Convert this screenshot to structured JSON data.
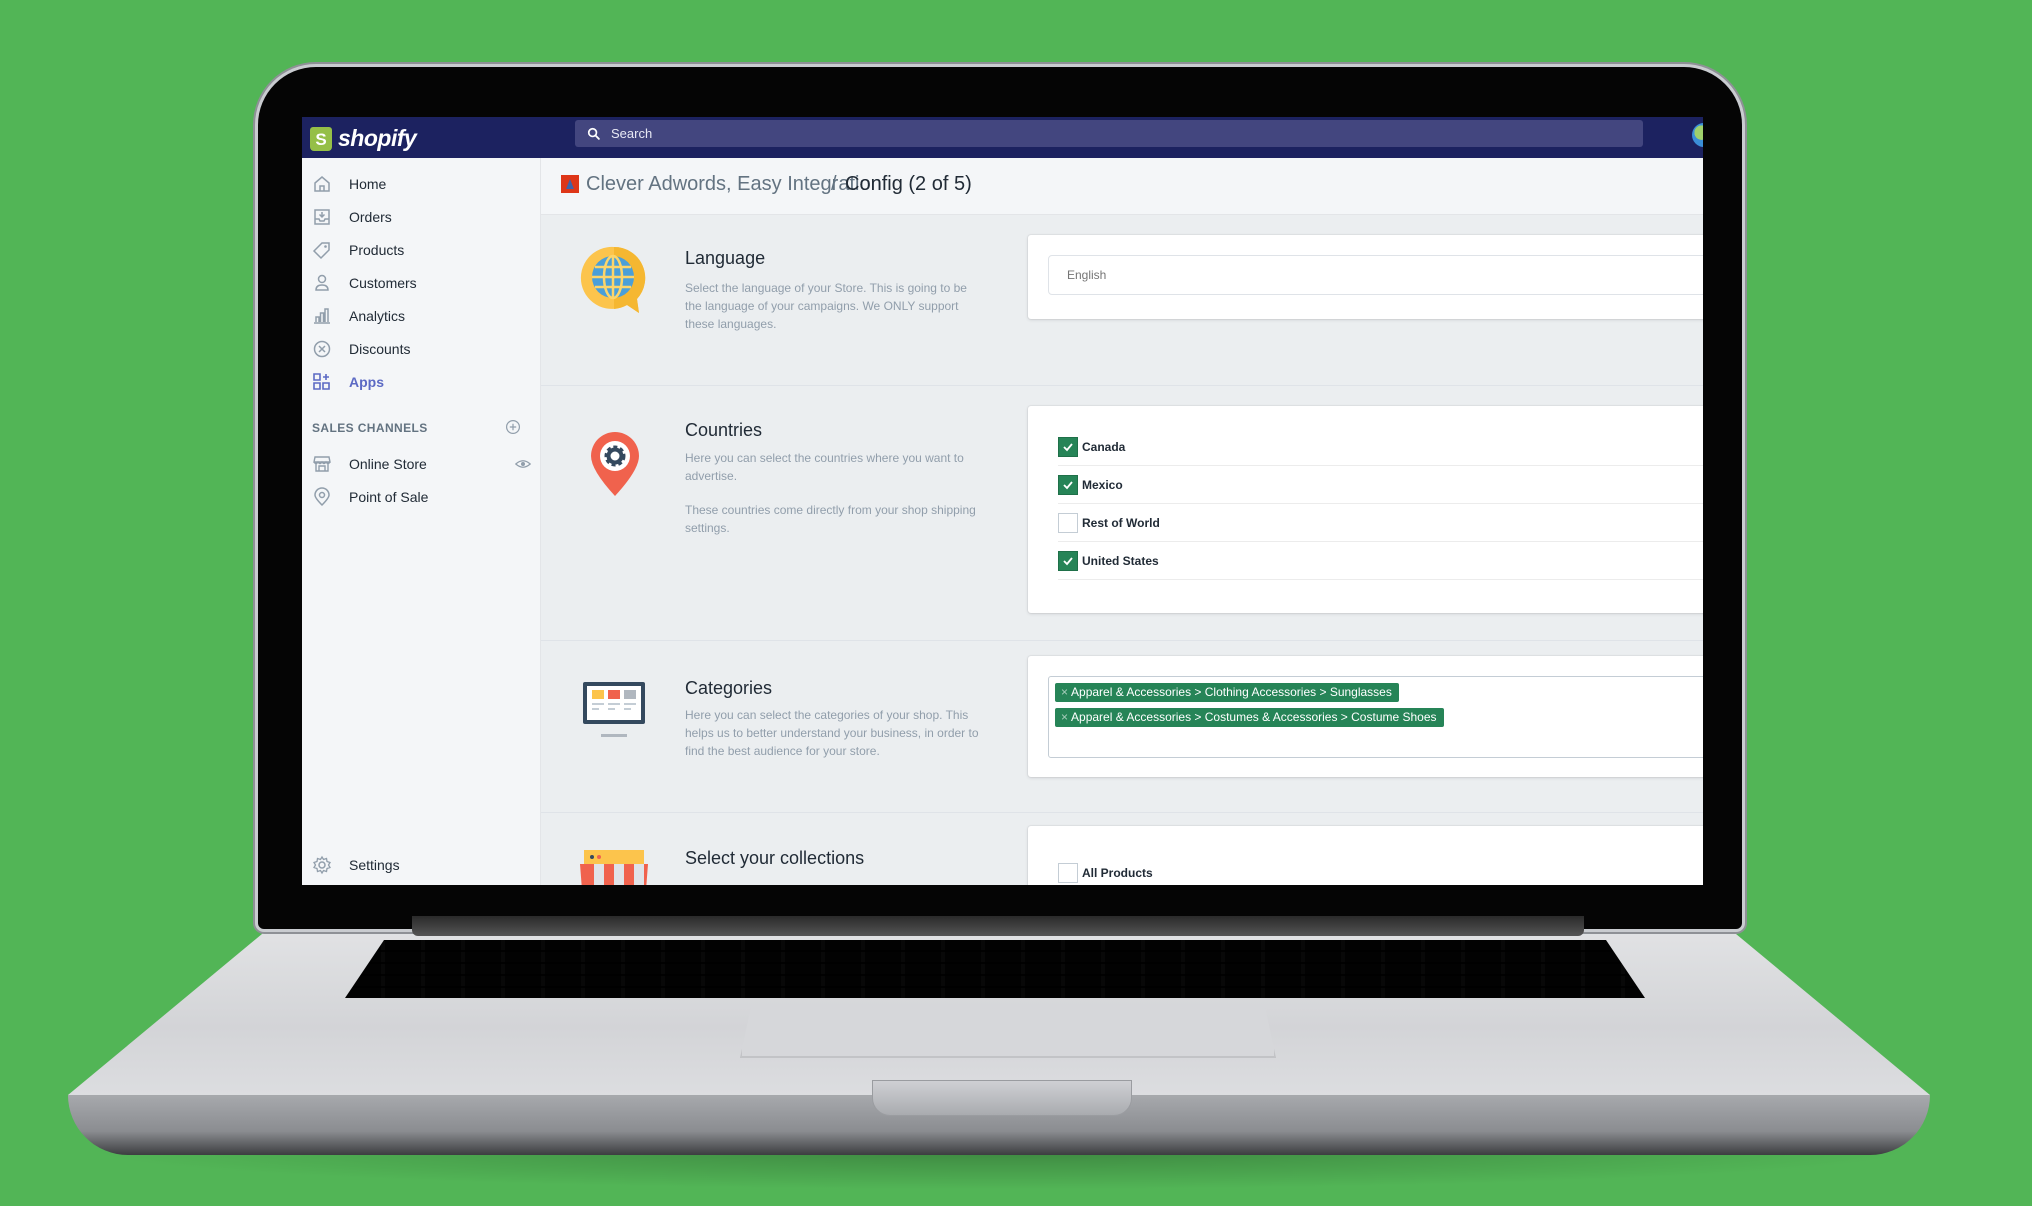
{
  "topbar": {
    "brand": "shopify",
    "logo_letter": "S",
    "search_placeholder": "Search"
  },
  "sidebar": {
    "items": [
      {
        "label": "Home",
        "icon": "home-icon"
      },
      {
        "label": "Orders",
        "icon": "orders-icon"
      },
      {
        "label": "Products",
        "icon": "tag-icon"
      },
      {
        "label": "Customers",
        "icon": "person-icon"
      },
      {
        "label": "Analytics",
        "icon": "bar-chart-icon"
      },
      {
        "label": "Discounts",
        "icon": "discount-icon"
      },
      {
        "label": "Apps",
        "icon": "apps-icon",
        "active": true
      }
    ],
    "sales_channels_heading": "SALES CHANNELS",
    "channels": [
      {
        "label": "Online Store",
        "icon": "store-icon"
      },
      {
        "label": "Point of Sale",
        "icon": "location-icon"
      }
    ],
    "settings_label": "Settings"
  },
  "breadcrumb": {
    "app_name": "Clever Adwords, Easy Integration",
    "separator": "/",
    "current": "Config (2 of 5)"
  },
  "sections": {
    "language": {
      "title": "Language",
      "description": "Select the language of your Store. This is going to be the language of your campaigns. We ONLY support these languages.",
      "selected": "English"
    },
    "countries": {
      "title": "Countries",
      "description_1": "Here you can select the countries where you want to advertise.",
      "description_2": "These countries come directly from your shop shipping settings.",
      "options": [
        {
          "label": "Canada",
          "checked": true
        },
        {
          "label": "Mexico",
          "checked": true
        },
        {
          "label": "Rest of World",
          "checked": false
        },
        {
          "label": "United States",
          "checked": true
        }
      ]
    },
    "categories": {
      "title": "Categories",
      "description": "Here you can select the categories of your shop. This helps us to better understand your business, in order to find the best audience for your store.",
      "tags": [
        "Apparel & Accessories > Clothing Accessories > Sunglasses",
        "Apparel & Accessories > Costumes & Accessories > Costume Shoes"
      ],
      "tag_remove_glyph": "×"
    },
    "collections": {
      "title": "Select your collections",
      "options": [
        {
          "label": "All Products",
          "checked": false
        }
      ]
    }
  },
  "colors": {
    "background": "#52b556",
    "topbar": "#1c2260",
    "search": "#43467f",
    "accent": "#5c6ac4",
    "checked": "#268457"
  }
}
